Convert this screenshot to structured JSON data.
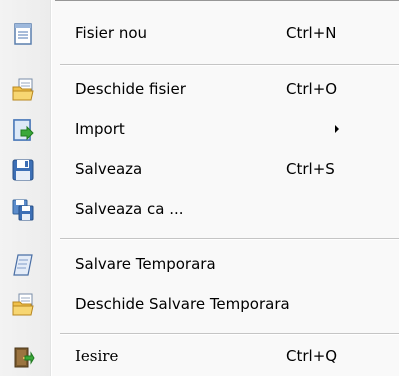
{
  "menu": {
    "items": [
      {
        "label": "Fisier nou",
        "shortcut": "Ctrl+N",
        "icon": "new-file-icon"
      },
      {
        "label": "Deschide fisier",
        "shortcut": "Ctrl+O",
        "icon": "open-folder-icon"
      },
      {
        "label": "Import",
        "shortcut": "",
        "icon": "import-icon",
        "submenu": true
      },
      {
        "label": "Salveaza",
        "shortcut": "Ctrl+S",
        "icon": "save-icon"
      },
      {
        "label": "Salveaza ca ...",
        "shortcut": "",
        "icon": "save-as-icon"
      },
      {
        "label": "Salvare Temporara",
        "shortcut": "",
        "icon": "scroll-icon"
      },
      {
        "label": "Deschide Salvare Temporara",
        "shortcut": "",
        "icon": "open-temp-save-icon"
      },
      {
        "label": "Iesire",
        "shortcut": "Ctrl+Q",
        "icon": "exit-door-icon"
      }
    ]
  },
  "colors": {
    "background": "#f9f9f9",
    "gutter": "#efefef",
    "separator": "#c5c5c5",
    "text": "#000000"
  }
}
